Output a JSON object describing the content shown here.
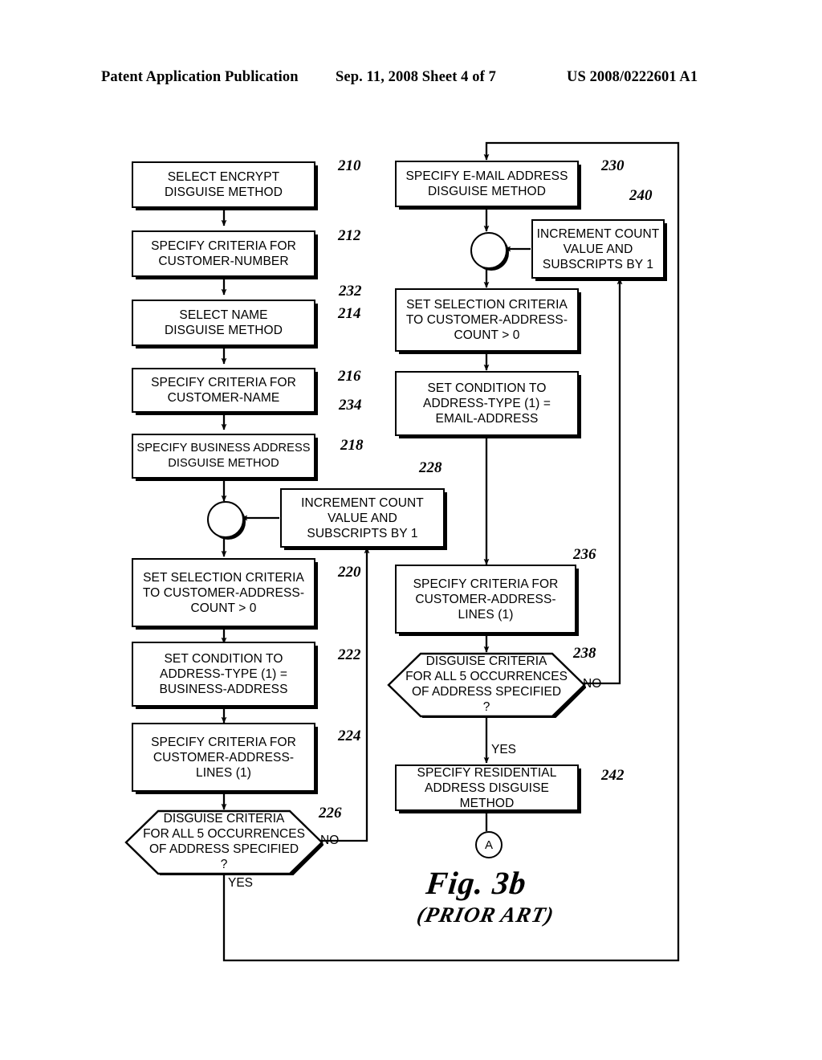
{
  "header": {
    "publication": "Patent Application Publication",
    "date_sheet": "Sep. 11, 2008  Sheet 4 of 7",
    "patent_number": "US 2008/0222601 A1"
  },
  "figure": {
    "caption": "Fig. 3b",
    "subcaption": "(PRIOR ART)",
    "connector_label": "A"
  },
  "colors": {
    "ink": "#000000",
    "paper": "#ffffff"
  },
  "branch_labels": {
    "yes": "YES",
    "no": "NO"
  },
  "nodes": [
    {
      "id": "210",
      "ref": "210",
      "text": "SELECT ENCRYPT\nDISGUISE METHOD"
    },
    {
      "id": "212",
      "ref": "212",
      "text": "SPECIFY CRITERIA FOR\nCUSTOMER-NUMBER"
    },
    {
      "id": "214",
      "ref": "214",
      "text": "SELECT NAME\nDISGUISE METHOD"
    },
    {
      "id": "216",
      "ref": "216",
      "text": "SPECIFY CRITERIA FOR\nCUSTOMER-NAME"
    },
    {
      "id": "218",
      "ref": "218",
      "text": "SPECIFY BUSINESS ADDRESS\nDISGUISE METHOD"
    },
    {
      "id": "228",
      "ref": "228",
      "text": "INCREMENT COUNT\nVALUE AND\nSUBSCRIPTS BY 1"
    },
    {
      "id": "220",
      "ref": "220",
      "text": "SET SELECTION CRITERIA\nTO CUSTOMER-ADDRESS-\nCOUNT > 0"
    },
    {
      "id": "222",
      "ref": "222",
      "text": "SET CONDITION TO\nADDRESS-TYPE (1) =\nBUSINESS-ADDRESS"
    },
    {
      "id": "224",
      "ref": "224",
      "text": "SPECIFY CRITERIA FOR\nCUSTOMER-ADDRESS-\nLINES (1)"
    },
    {
      "id": "226",
      "ref": "226",
      "text": "DISGUISE CRITERIA\nFOR ALL 5 OCCURRENCES\nOF ADDRESS SPECIFIED\n?"
    },
    {
      "id": "230",
      "ref": "230",
      "text": "SPECIFY E-MAIL ADDRESS\nDISGUISE METHOD"
    },
    {
      "id": "240",
      "ref": "240",
      "text": "INCREMENT COUNT\nVALUE AND\nSUBSCRIPTS BY 1"
    },
    {
      "id": "232",
      "ref": "232",
      "text": "SET SELECTION CRITERIA\nTO CUSTOMER-ADDRESS-\nCOUNT > 0"
    },
    {
      "id": "234",
      "ref": "234",
      "text": "SET CONDITION TO\nADDRESS-TYPE (1) =\nEMAIL-ADDRESS"
    },
    {
      "id": "236",
      "ref": "236",
      "text": "SPECIFY CRITERIA FOR\nCUSTOMER-ADDRESS-\nLINES (1)"
    },
    {
      "id": "238",
      "ref": "238",
      "text": "DISGUISE CRITERIA\nFOR ALL 5 OCCURRENCES\nOF ADDRESS SPECIFIED\n?"
    },
    {
      "id": "242",
      "ref": "242",
      "text": "SPECIFY RESIDENTIAL\nADDRESS DISGUISE METHOD"
    }
  ]
}
